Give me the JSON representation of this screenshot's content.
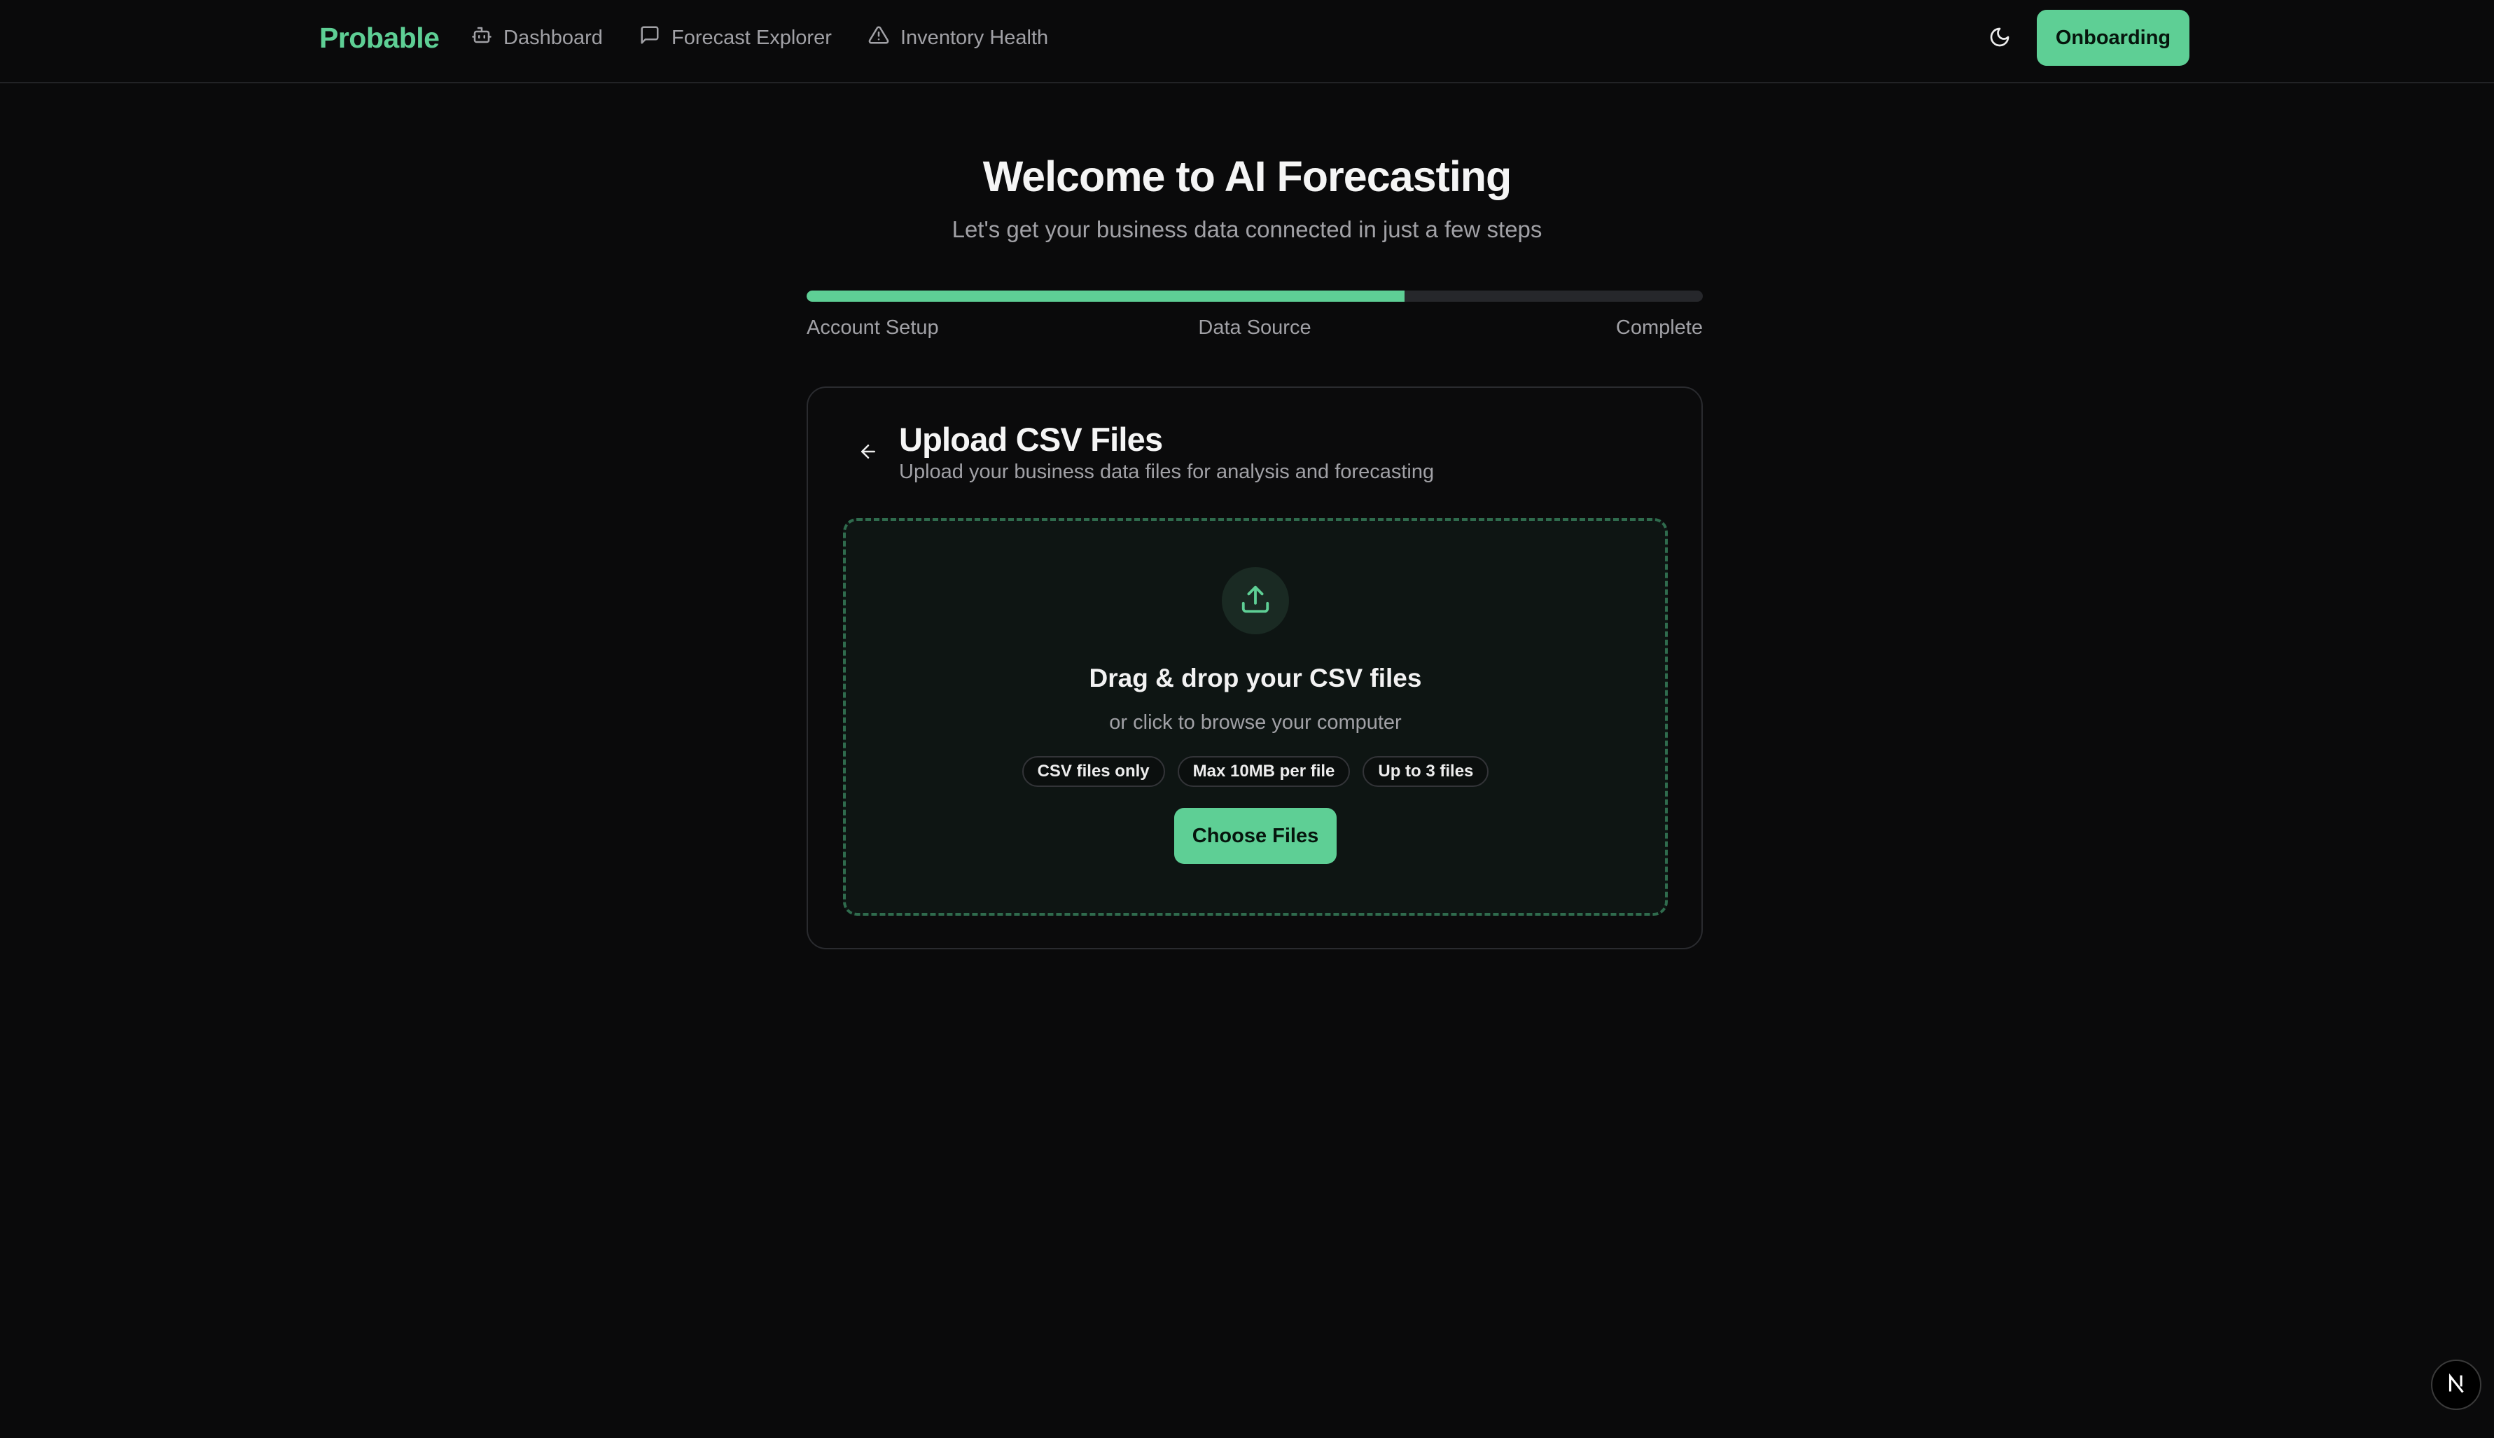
{
  "nav": {
    "brand": "Probable",
    "links": [
      {
        "label": "Dashboard",
        "icon": "bot-icon"
      },
      {
        "label": "Forecast Explorer",
        "icon": "message-square-icon"
      },
      {
        "label": "Inventory Health",
        "icon": "alert-triangle-icon"
      }
    ],
    "theme_icon": "moon-icon",
    "cta_label": "Onboarding"
  },
  "hero": {
    "title": "Welcome to AI Forecasting",
    "subtitle": "Let's get your business data connected in just a few steps"
  },
  "progress": {
    "percent": 66.7,
    "steps": [
      "Account Setup",
      "Data Source",
      "Complete"
    ]
  },
  "card": {
    "title": "Upload CSV Files",
    "subtitle": "Upload your business data files for analysis and forecasting",
    "dropzone": {
      "title": "Drag & drop your CSV files",
      "subtitle": "or click to browse your computer",
      "badges": [
        "CSV files only",
        "Max 10MB per file",
        "Up to 3 files"
      ],
      "button_label": "Choose Files"
    }
  },
  "colors": {
    "accent": "#5ecf95",
    "background": "#0a0a0b",
    "muted_text": "#a1a1a6"
  }
}
